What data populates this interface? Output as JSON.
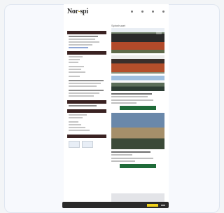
{
  "site": {
    "logo_main": "Nor",
    "logo_dash": "-",
    "logo_end": "spi"
  },
  "main": {
    "title": "Spinnhuset"
  },
  "colors": {
    "sidebar_header": "#3a2222",
    "green_button": "#1f6b39",
    "cookie_bar": "#2a2a2a",
    "cookie_accept": "#f0d21c"
  },
  "icons": {
    "nav": [
      "nav-dot-icon",
      "nav-dot-icon",
      "nav-dot-icon",
      "nav-dot-icon"
    ],
    "photo_badge": "image-icon"
  }
}
